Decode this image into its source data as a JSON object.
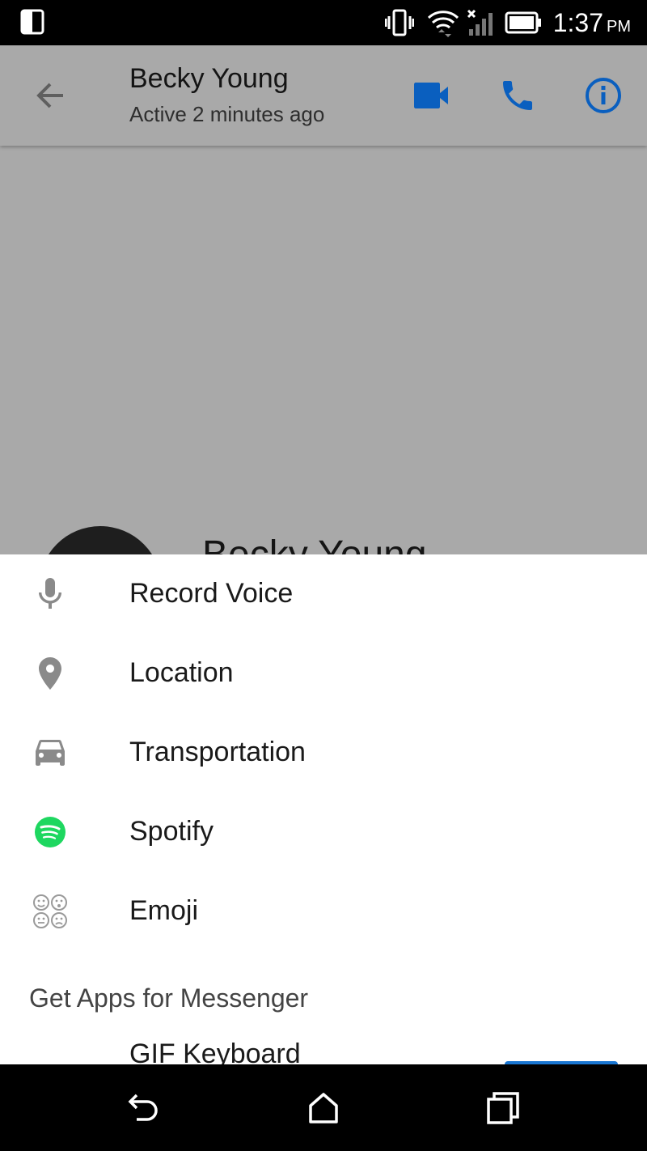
{
  "status_bar": {
    "time": "1:37",
    "ampm": "PM",
    "icons": [
      "screen-mirror-icon",
      "vibrate-icon",
      "wifi-icon",
      "cell-signal-icon",
      "battery-icon"
    ]
  },
  "header": {
    "title": "Becky Young",
    "subtitle": "Active 2 minutes ago",
    "icons": [
      "back-arrow-icon",
      "video-call-icon",
      "phone-icon",
      "info-icon"
    ],
    "accent_color": "#0a5fbf"
  },
  "chat": {
    "profile_name": "Becky Young"
  },
  "menu": {
    "items": [
      {
        "label": "Record Voice",
        "icon": "microphone-icon"
      },
      {
        "label": "Location",
        "icon": "location-pin-icon"
      },
      {
        "label": "Transportation",
        "icon": "car-icon"
      },
      {
        "label": "Spotify",
        "icon": "spotify-icon",
        "color": "#1ed760"
      },
      {
        "label": "Emoji",
        "icon": "emoji-icon"
      }
    ],
    "section_title": "Get Apps for Messenger",
    "apps": [
      {
        "label": "GIF Keyboard",
        "button_color": "#1976d2"
      }
    ]
  },
  "nav_bar": {
    "icons": [
      "back-icon",
      "home-icon",
      "recents-icon"
    ]
  }
}
